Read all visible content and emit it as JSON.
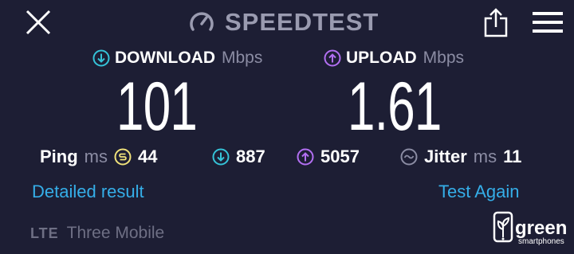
{
  "header": {
    "brand": "SPEEDTEST",
    "icons": [
      "close-icon",
      "gauge-icon",
      "share-icon",
      "hamburger-menu-icon"
    ]
  },
  "download": {
    "label": "DOWNLOAD",
    "unit": "Mbps",
    "value": "101",
    "icon": "download-arrow-icon",
    "color": "#35c3d8"
  },
  "upload": {
    "label": "UPLOAD",
    "unit": "Mbps",
    "value": "1.61",
    "icon": "upload-arrow-icon",
    "color": "#b26ff2"
  },
  "stats": {
    "ping_label": "Ping",
    "ping_unit": "ms",
    "ping_value": "44",
    "download_ping": "887",
    "upload_ping": "5057",
    "jitter_label": "Jitter",
    "jitter_unit": "ms",
    "jitter_value": "11"
  },
  "actions": {
    "detailed": "Detailed result",
    "again": "Test Again"
  },
  "network": {
    "tech": "LTE",
    "carrier": "Three Mobile"
  },
  "watermark": {
    "word": "green",
    "sub": "smartphones"
  },
  "colors": {
    "background": "#1d1e34",
    "link": "#35aee8",
    "ping": "#f0e27a",
    "muted": "#8b8ca3"
  }
}
